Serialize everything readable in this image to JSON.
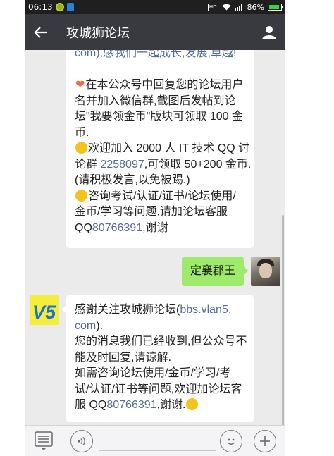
{
  "status_bar": {
    "time": "06:13",
    "hd_label": "HD",
    "battery_text": "86%",
    "battery_level": 0.86
  },
  "nav": {
    "title": "攻城狮论坛"
  },
  "messages": {
    "first": {
      "lines": [
        "com),感我们一起成长,发展,草越!",
        "",
        "在本公众号中回复您的论坛用户",
        "名并加入微信群,截图后发帖到论",
        "坛\"我要领金币\"版块可领取 100 金",
        "币.",
        "欢迎加入 2000 人 IT 技术 QQ 讨",
        "论群 ",
        "2258097",
        ",可领取 50+200 金币.",
        "(请积极发言,以免被踢.)",
        "咨询考试/认证/证书/论坛使用/",
        "金币/学习等问题,请加论坛客服",
        "QQ",
        "80766391",
        ",谢谢"
      ]
    },
    "outgoing": {
      "text": "定襄郡王"
    },
    "second": {
      "lines": [
        "感谢关注攻城狮论坛(",
        "bbs.vlan5.",
        "com",
        ").",
        "您的消息我们已经收到,但公众号不",
        "能及时回复,请谅解.",
        "如需咨询论坛使用/金币/学习/考",
        "试/认证/证书等问题,欢迎加论坛客",
        "服 QQ",
        "80766391",
        ",谢谢."
      ]
    },
    "left_avatar_logo": "V5"
  },
  "colors": {
    "nav_bg": "#393a3f",
    "chat_bg": "#ebebeb",
    "outgoing_bubble": "#9eea6a",
    "link": "#576b95"
  }
}
